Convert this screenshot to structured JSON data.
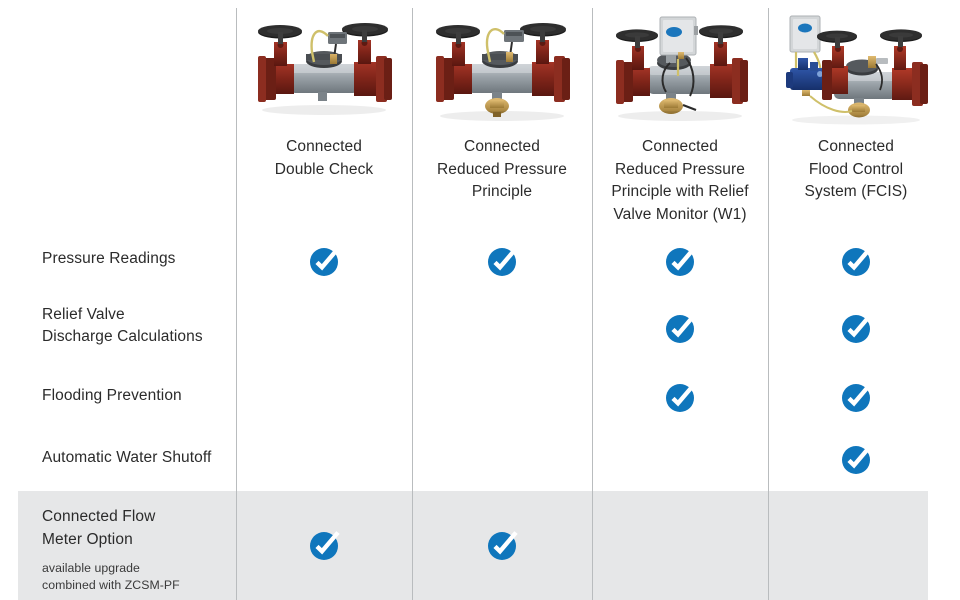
{
  "accent_color": "#0f76bc",
  "highlight_row_color": "#e6e7e8",
  "divider_color": "#b9bcbe",
  "text_color": "#2b2b2b",
  "columns": [
    {
      "id": "connected-double-check",
      "label": "Connected\nDouble Check",
      "image_name": "connected-double-check-product-photo"
    },
    {
      "id": "connected-reduced-pressure-principle",
      "label": "Connected\nReduced Pressure\nPrinciple",
      "image_name": "connected-reduced-pressure-principle-product-photo"
    },
    {
      "id": "connected-rpp-relief-valve-monitor-w1",
      "label": "Connected\nReduced Pressure\nPrinciple with Relief\nValve Monitor (W1)",
      "image_name": "connected-rpp-relief-valve-monitor-product-photo"
    },
    {
      "id": "connected-flood-control-system-fcis",
      "label": "Connected\nFlood Control\nSystem (FCIS)",
      "image_name": "connected-flood-control-system-product-photo"
    }
  ],
  "features": [
    {
      "id": "pressure-readings",
      "label": "Pressure Readings",
      "support": [
        true,
        true,
        true,
        true
      ]
    },
    {
      "id": "relief-valve-discharge-calculations",
      "label": "Relief Valve\nDischarge Calculations",
      "support": [
        false,
        false,
        true,
        true
      ]
    },
    {
      "id": "flooding-prevention",
      "label": "Flooding Prevention",
      "support": [
        false,
        false,
        true,
        true
      ]
    },
    {
      "id": "automatic-water-shutoff",
      "label": "Automatic Water Shutoff",
      "support": [
        false,
        false,
        false,
        true
      ]
    }
  ],
  "option_row": {
    "id": "connected-flow-meter-option",
    "title": "Connected Flow\nMeter Option",
    "subtext": "available upgrade\ncombined with ZCSM-PF",
    "support": [
      true,
      true,
      false,
      false
    ]
  },
  "icons": {
    "check": "check-circle-icon"
  }
}
